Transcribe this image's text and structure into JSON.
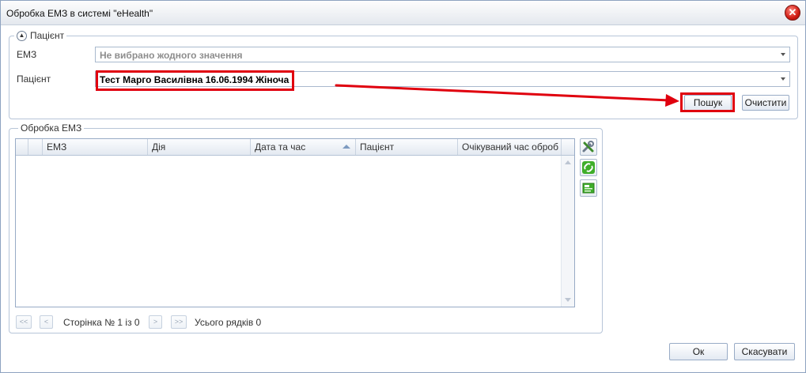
{
  "window": {
    "title": "Обробка ЕМЗ в системі \"eHealth\"",
    "close_glyph": "✕"
  },
  "patient_group": {
    "legend": "Пацієнт",
    "collapse_glyph": "▲",
    "emz_label": "ЕМЗ",
    "emz_placeholder": "Не вибрано жодного значення",
    "patient_label": "Пацієнт",
    "patient_value": "Тест Марго Василівна 16.06.1994 Жіноча",
    "search_button": "Пошук",
    "clear_button": "Очистити"
  },
  "emz_group": {
    "legend": "Обробка ЕМЗ",
    "columns": [
      "ЕМЗ",
      "Дія",
      "Дата та час",
      "Пацієнт",
      "Очікуваний час оброб"
    ],
    "rows": [],
    "sorted_column": "Дата та час"
  },
  "toolbar": {
    "icons": [
      "tools-icon",
      "link-icon",
      "card-icon"
    ]
  },
  "pager": {
    "first": "<<",
    "prev": "<",
    "next": ">",
    "last": ">>",
    "page_text": "Сторінка № 1 із 0",
    "rows_text": "Усього рядків 0"
  },
  "footer": {
    "ok": "Ок",
    "cancel": "Скасувати"
  },
  "colors": {
    "highlight": "#e0000e",
    "arrow": "#e0000e",
    "border": "#b7c5d8"
  }
}
